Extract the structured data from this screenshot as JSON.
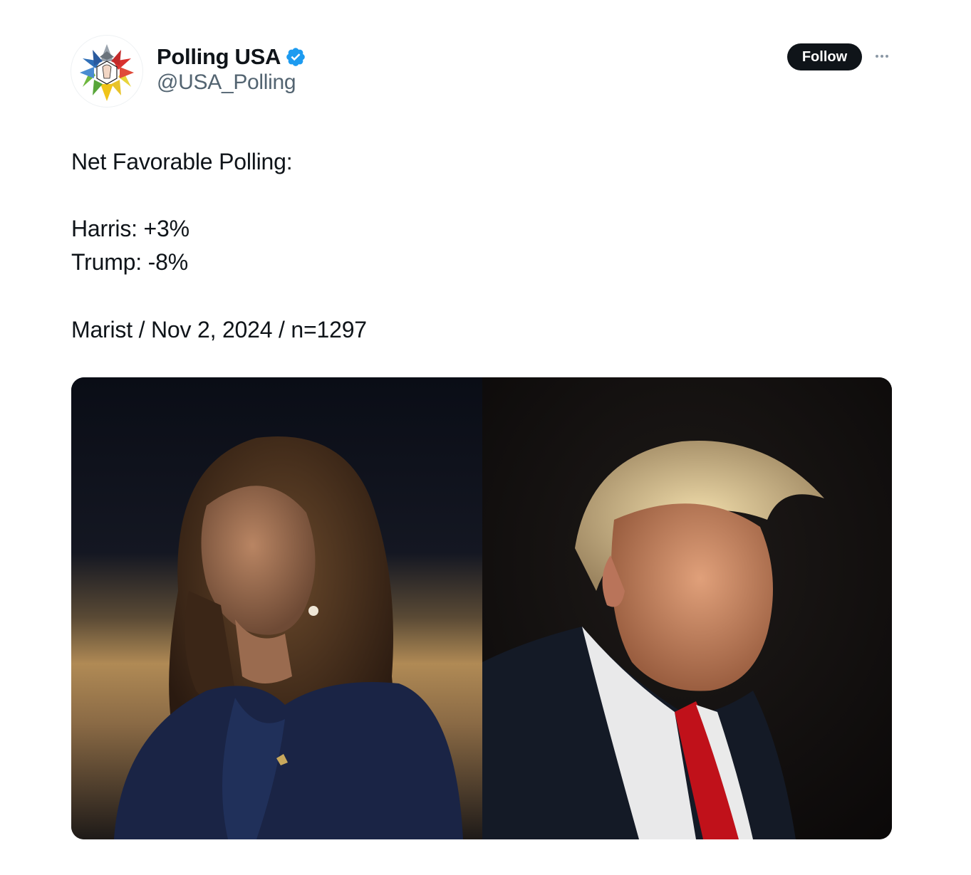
{
  "author": {
    "name": "Polling USA",
    "handle": "@USA_Polling",
    "verified": true,
    "verified_color": "#1d9bf0"
  },
  "actions": {
    "follow_label": "Follow",
    "more_icon": "more-horizontal-icon"
  },
  "tweet": {
    "lines": [
      "Net Favorable Polling:",
      "Harris: +3%",
      "Trump: -8%",
      "Marist / Nov 2, 2024 / n=1297"
    ]
  },
  "media": {
    "images": [
      {
        "subject": "harris-portrait"
      },
      {
        "subject": "trump-portrait"
      }
    ]
  },
  "colors": {
    "text_primary": "#0f1419",
    "text_secondary": "#536471",
    "follow_bg": "#0f1419"
  }
}
